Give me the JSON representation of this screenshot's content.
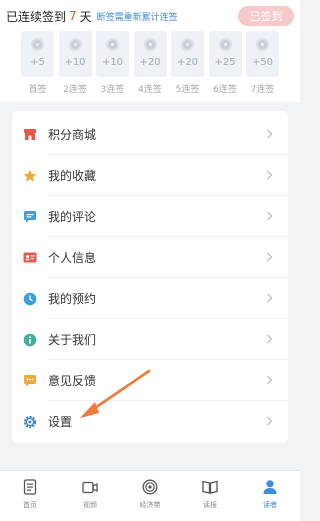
{
  "checkin": {
    "title": "已连续签到",
    "days": "7",
    "unit": "天",
    "rule": "断签需重新累计连签",
    "button": "已签到",
    "items": [
      {
        "points": "+5",
        "label": "首签"
      },
      {
        "points": "+10",
        "label": "2连签"
      },
      {
        "points": "+10",
        "label": "3连签"
      },
      {
        "points": "+20",
        "label": "4连签"
      },
      {
        "points": "+20",
        "label": "5连签"
      },
      {
        "points": "+25",
        "label": "6连签"
      },
      {
        "points": "+50",
        "label": "7连签"
      }
    ]
  },
  "menu": {
    "items": [
      {
        "label": "积分商城",
        "icon": "store-icon",
        "color": "#e8574a"
      },
      {
        "label": "我的收藏",
        "icon": "star-icon",
        "color": "#f2a93b"
      },
      {
        "label": "我的评论",
        "icon": "comment-icon",
        "color": "#3aa0e0"
      },
      {
        "label": "个人信息",
        "icon": "id-card-icon",
        "color": "#e8574a"
      },
      {
        "label": "我的预约",
        "icon": "clock-icon",
        "color": "#3aa0e0"
      },
      {
        "label": "关于我们",
        "icon": "info-icon",
        "color": "#3fae9b"
      },
      {
        "label": "意见反馈",
        "icon": "feedback-icon",
        "color": "#f2a93b"
      },
      {
        "label": "设置",
        "icon": "gear-icon",
        "color": "#3a7fd5"
      }
    ]
  },
  "tabs": [
    {
      "label": "首页",
      "icon": "home-icon"
    },
    {
      "label": "视频",
      "icon": "video-icon"
    },
    {
      "label": "经济带",
      "icon": "radar-icon"
    },
    {
      "label": "读报",
      "icon": "newspaper-icon"
    },
    {
      "label": "读者",
      "icon": "user-icon",
      "active": true
    }
  ],
  "colors": {
    "accent": "#3f8bdc",
    "days_highlight": "#e84c3d",
    "arrow": "#f07a3a",
    "signed_button": "#f6c9cb"
  }
}
